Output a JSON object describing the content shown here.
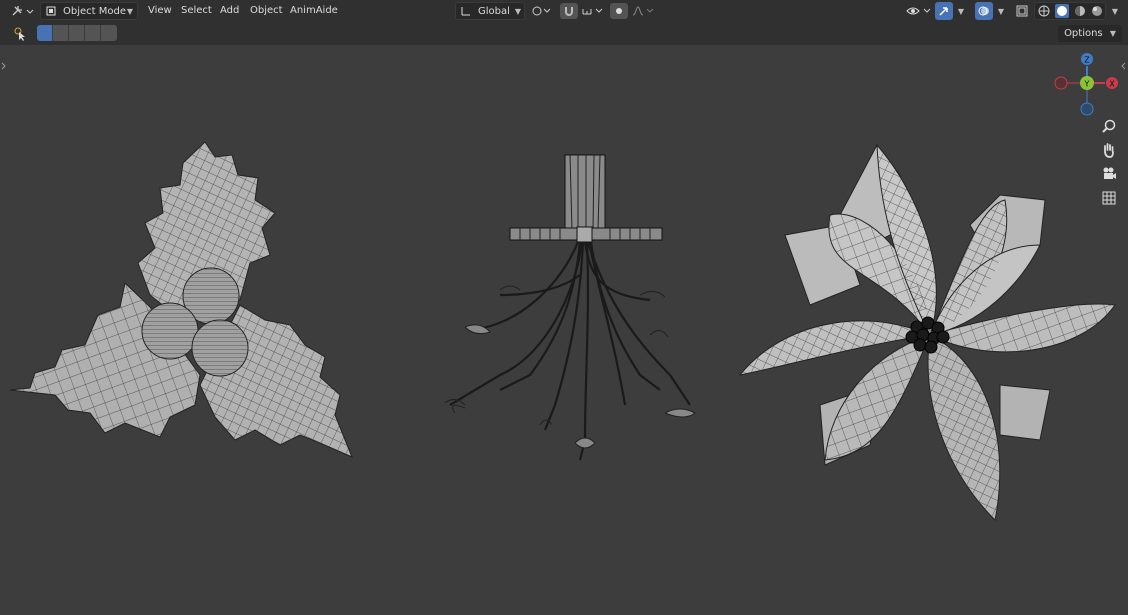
{
  "header": {
    "mode_label": "Object Mode",
    "menus": [
      "View",
      "Select",
      "Add",
      "Object",
      "AnimAide"
    ],
    "transform_orientation": "Global"
  },
  "toolbar": {
    "options_label": "Options"
  },
  "gizmo": {
    "z_label": "Z",
    "y_label": "Y",
    "x_label": "X",
    "colors": {
      "x": "#c83c4a",
      "y": "#8bc23a",
      "z": "#3f7dc8"
    }
  },
  "viewport": {
    "objects": [
      "holly-leaves-with-berries",
      "mistletoe",
      "poinsettia"
    ]
  },
  "colors": {
    "accent": "#4772b3",
    "header_bg": "#303030",
    "viewport_bg": "#3d3d3d"
  }
}
